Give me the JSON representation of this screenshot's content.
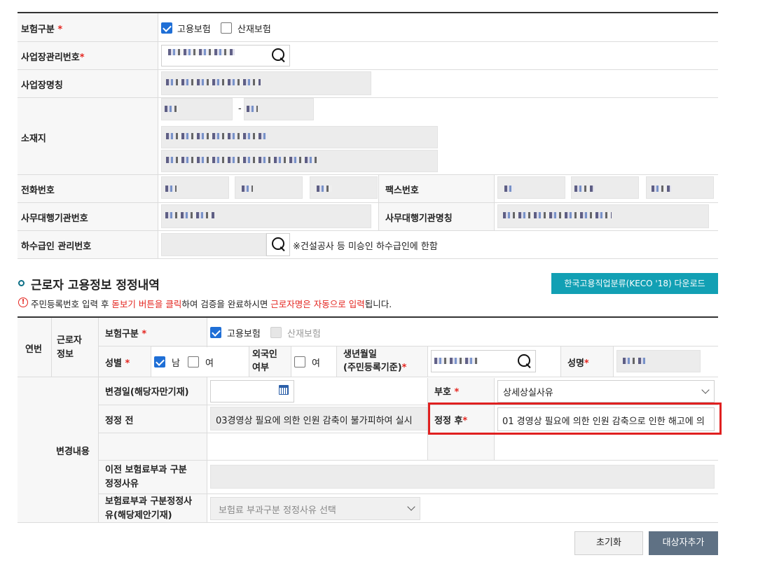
{
  "section1": {
    "insurance_type": {
      "label": "보험구분",
      "star": "*",
      "opt1": "고용보험",
      "opt2": "산재보험"
    },
    "biz_mgmt_no": {
      "label": "사업장관리번호",
      "star": "*"
    },
    "biz_name": {
      "label": "사업장명칭"
    },
    "address": {
      "label": "소재지"
    },
    "phone": {
      "label": "전화번호"
    },
    "fax": {
      "label": "팩스번호"
    },
    "agency_no": {
      "label": "사무대행기관번호"
    },
    "agency_name": {
      "label": "사무대행기관명칭"
    },
    "subcontractor": {
      "label": "하수급인 관리번호",
      "note": "※건설공사 등 미승인 하수급인에 한함"
    }
  },
  "section2": {
    "title": "근로자 고용정보 정정내역",
    "download_button": "한국고용직업분류(KECO '18) 다운로드",
    "notice": {
      "p1": "주민등록번호 입력 후 ",
      "h1": "돋보기 버튼을 클릭",
      "p2": "하여 검증을 완료하시면 ",
      "h2": "근로자명은 자동으로 입력",
      "p3": "됩니다."
    }
  },
  "table": {
    "col_no": "연번",
    "worker_info": [
      "근로자",
      "정보"
    ],
    "insurance_type": {
      "label": "보험구분",
      "star": "*",
      "opt1": "고용보험",
      "opt2": "산재보험"
    },
    "gender": {
      "label": "성별",
      "star": "*",
      "male": "남",
      "female": "여"
    },
    "foreigner": {
      "label": [
        "외국인",
        "여부"
      ],
      "opt": "여"
    },
    "birth": {
      "label": [
        "생년월일",
        "(주민등록기준)"
      ],
      "star": "*"
    },
    "name": {
      "label": "성명",
      "star": "*"
    },
    "change_section": "변경내용",
    "change_date": {
      "label": "변경일(해당자만기재)"
    },
    "code": {
      "label": "부호",
      "star": "*",
      "value": "상세상실사유"
    },
    "before": {
      "label": "정정 전",
      "value": "03경영상 필요에 의한 인원 감축이 불가피하여 실시"
    },
    "after": {
      "label": "정정 후",
      "star": "*",
      "value": "01 경영상 필요에 의한 인원 감축으로 인한 해고에 의"
    },
    "prev_reason": {
      "label": [
        "이전 보험료부과 구분",
        "정정사유"
      ]
    },
    "reason": {
      "label": [
        "보험료부과 구분정정사",
        "유(해당제안기재)"
      ],
      "placeholder": "보험료 부과구분 정정사유 선택"
    }
  },
  "buttons": {
    "reset": "초기화",
    "add": "대상자추가"
  },
  "colors": {
    "accent": "#1f6fd6",
    "teal": "#12a0b4",
    "red": "#e4251f",
    "highlight_box": "#e02020"
  },
  "icons": [
    "search-icon",
    "calendar-icon",
    "chevron-down-icon",
    "checkbox-icon",
    "alert-icon",
    "bullet-icon"
  ]
}
